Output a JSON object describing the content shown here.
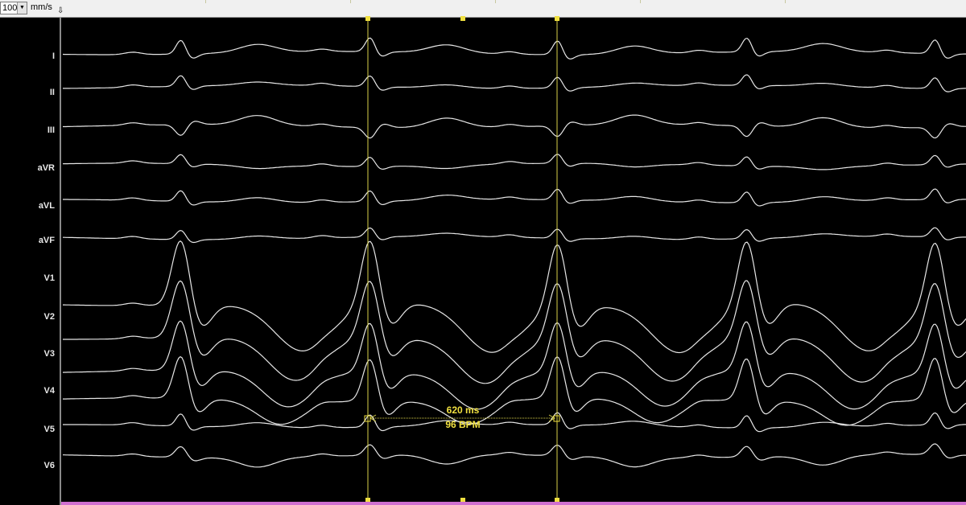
{
  "toolbar": {
    "speed_value": "100",
    "speed_unit": "mm/s",
    "dropdown_glyph": "▼",
    "cursor_glyph": "⇩"
  },
  "leads": [
    "I",
    "II",
    "III",
    "aVR",
    "aVL",
    "aVF",
    "V1",
    "V2",
    "V3",
    "V4",
    "V5",
    "V6"
  ],
  "measurement": {
    "interval": "620 ms",
    "rate": "96 BPM"
  },
  "colors": {
    "trace": "#e6e6e6",
    "caliper": "#d8d048",
    "caliper_text": "#f0e040",
    "background": "#000000"
  }
}
